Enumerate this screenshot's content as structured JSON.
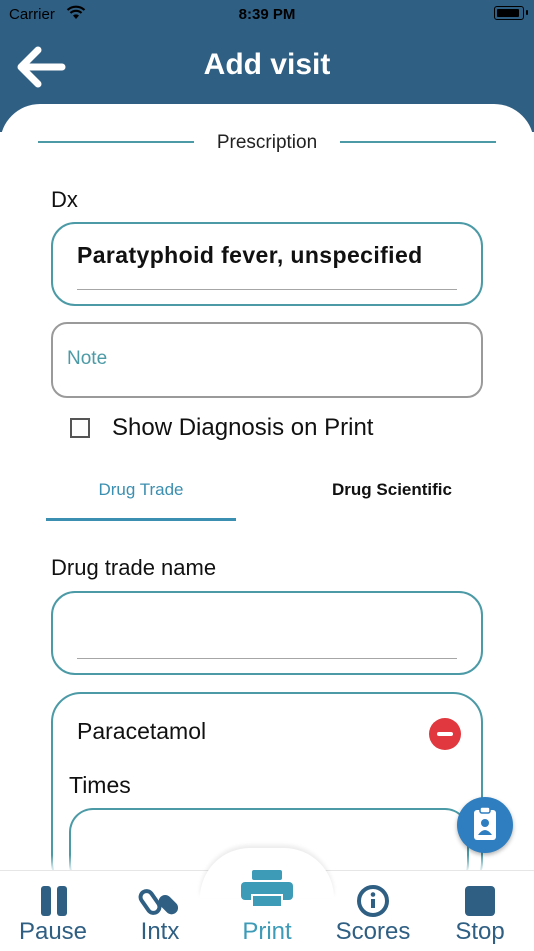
{
  "status_bar": {
    "carrier": "Carrier",
    "time": "8:39 PM"
  },
  "header": {
    "title": "Add visit"
  },
  "section": {
    "title": "Prescription"
  },
  "dx": {
    "label": "Dx",
    "value": "Paratyphoid fever, unspecified"
  },
  "note": {
    "placeholder": "Note"
  },
  "show_diagnosis": {
    "label": "Show Diagnosis on Print",
    "checked": false
  },
  "tabs": [
    {
      "label": "Drug Trade",
      "active": true
    },
    {
      "label": "Drug Scientific",
      "active": false
    }
  ],
  "drug_trade": {
    "label": "Drug trade name",
    "value": ""
  },
  "drug_card": {
    "name": "Paracetamol",
    "times_label": "Times"
  },
  "bottom_nav": [
    {
      "label": "Pause",
      "icon": "pause-icon"
    },
    {
      "label": "Intx",
      "icon": "pills-icon"
    },
    {
      "label": "Print",
      "icon": "printer-icon",
      "active": true
    },
    {
      "label": "Scores",
      "icon": "info-icon"
    },
    {
      "label": "Stop",
      "icon": "stop-icon"
    }
  ],
  "colors": {
    "header": "#2f5f83",
    "accent": "#4b9aa6",
    "tab_active": "#3b8fb0",
    "danger": "#e0383e",
    "fab": "#2f7ec0"
  }
}
